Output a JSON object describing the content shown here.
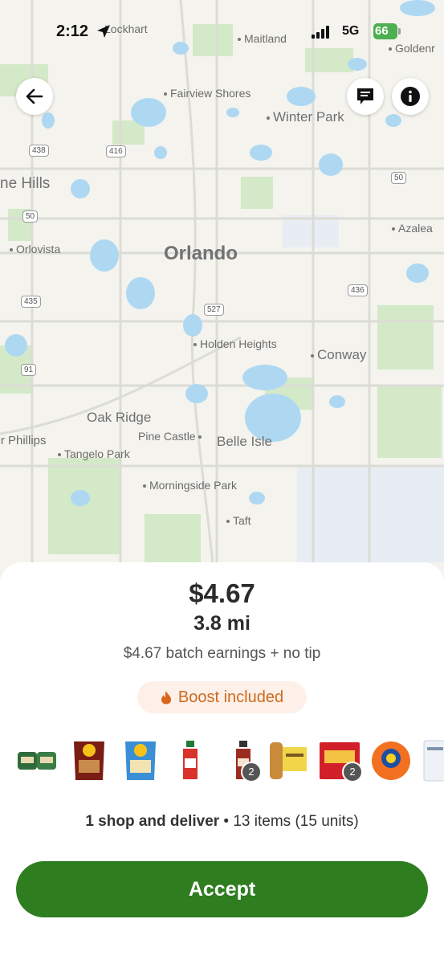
{
  "status_bar": {
    "time": "2:12",
    "network": "5G",
    "battery": "66"
  },
  "map": {
    "labels": {
      "lockhart": "Lockhart",
      "maitland": "Maitland",
      "golden": "Goldenr",
      "fairview": "Fairview Shores",
      "winter_park": "Winter Park",
      "hills": "ne Hills",
      "azalea": "Azalea",
      "orlovista": "Orlovista",
      "orlando": "Orlando",
      "holden": "Holden Heights",
      "conway": "Conway",
      "oak_ridge": "Oak Ridge",
      "pine_castle": "Pine Castle",
      "belle_isle": "Belle Isle",
      "dr_phillips": "Dr Phillips",
      "tangelo": "Tangelo Park",
      "morningside": "Morningside Park",
      "taft": "Taft"
    },
    "shields": {
      "s438": "438",
      "s416": "416",
      "s50a": "50",
      "s50b": "50",
      "s435": "435",
      "s527": "527",
      "s436": "436",
      "s91": "91"
    }
  },
  "offer": {
    "price": "$4.67",
    "distance": "3.8 mi",
    "earnings": "$4.67 batch earnings + no tip",
    "boost_label": "Boost included",
    "summary_bold": "1 shop and deliver",
    "summary_rest": " • 13 items (15 units)",
    "accept_label": "Accept",
    "item_badges": {
      "item5": "2",
      "item7": "2"
    }
  },
  "colors": {
    "accept": "#2e7d1f",
    "boost_text": "#cd6a1e",
    "boost_bg": "#fdf0e8",
    "water": "#aed8f2",
    "park": "#cfe8c4"
  }
}
